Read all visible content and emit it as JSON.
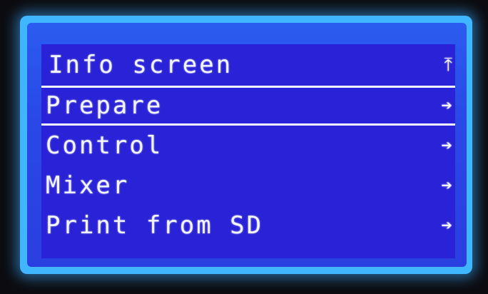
{
  "menu": {
    "items": [
      {
        "label": "Info screen",
        "arrow": "⤒"
      },
      {
        "label": "Prepare",
        "arrow": "➔"
      },
      {
        "label": "Control",
        "arrow": "➔"
      },
      {
        "label": "Mixer",
        "arrow": "➔"
      },
      {
        "label": "Print from SD",
        "arrow": "➔"
      }
    ],
    "selected_index": 1
  },
  "colors": {
    "screen_background": "#2a22d6",
    "text": "#f2f4ff",
    "backlight": "#3fb6ff"
  }
}
